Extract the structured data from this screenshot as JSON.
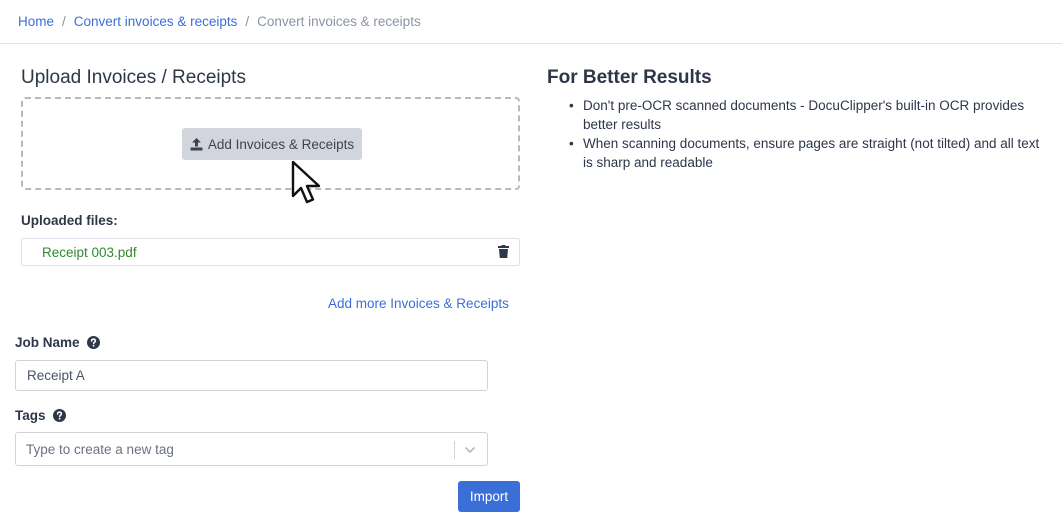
{
  "breadcrumb": {
    "items": [
      {
        "label": "Home",
        "link": true
      },
      {
        "label": "Convert invoices & receipts",
        "link": true
      },
      {
        "label": "Convert invoices & receipts",
        "link": false
      }
    ],
    "separator": "/"
  },
  "upload": {
    "title": "Upload Invoices / Receipts",
    "add_button_label": "Add Invoices & Receipts",
    "add_button_icon": "upload-icon"
  },
  "uploaded": {
    "label": "Uploaded files:",
    "files": [
      {
        "name": "Receipt 003.pdf",
        "delete_icon": "trash-icon"
      }
    ],
    "add_more_label": "Add more Invoices & Receipts"
  },
  "job_name": {
    "label": "Job Name",
    "value": "Receipt A"
  },
  "tags": {
    "label": "Tags",
    "placeholder": "Type to create a new tag"
  },
  "import_label": "Import",
  "tips": {
    "title": "For Better Results",
    "items": [
      "Don't pre-OCR scanned documents - DocuClipper's built-in OCR provides better results",
      "When scanning documents, ensure pages are straight (not tilted) and all text is sharp and readable"
    ]
  },
  "colors": {
    "primary": "#3b6fd8",
    "link": "#3b6fd8",
    "file_name": "#2f8a2f",
    "button_gray": "#d2d6dc"
  }
}
